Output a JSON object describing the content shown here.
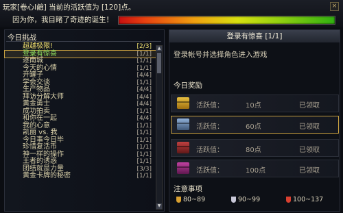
{
  "header": {
    "line1": "玩家[卷心I鹼] 当前的活跃值为 [120]点。",
    "line2": "因为你，我目睹了奇迹的诞生！",
    "close": "×"
  },
  "left": {
    "title": "今日挑战",
    "items": [
      {
        "name": "超越极限!",
        "count": "[2/3]",
        "hot": true
      },
      {
        "name": "登录有惊喜",
        "count": "[1/1]",
        "sel": true
      },
      {
        "name": "逐南城",
        "count": "[1/1]"
      },
      {
        "name": "今天的心情",
        "count": "[1/1]"
      },
      {
        "name": "开罐子",
        "count": "[4/4]"
      },
      {
        "name": "学会交谈",
        "count": "[1/1]"
      },
      {
        "name": "生产物品",
        "count": "[4/4]"
      },
      {
        "name": "拜访分解大师",
        "count": "[4/4]"
      },
      {
        "name": "黄金勇士",
        "count": "[4/4]"
      },
      {
        "name": "成功拍卖",
        "count": "[1/1]"
      },
      {
        "name": "和你在一起",
        "count": "[4/4]"
      },
      {
        "name": "我的心意",
        "count": "[1/1]"
      },
      {
        "name": "凯丽 vs. 我",
        "count": "[1/1]"
      },
      {
        "name": "今日事今日毕",
        "count": "[1/1]"
      },
      {
        "name": "珍惜复活币",
        "count": "[1/1]"
      },
      {
        "name": "神一样的操作",
        "count": "[1/1]"
      },
      {
        "name": "王者的诱惑",
        "count": "[1/1]"
      },
      {
        "name": "团结就是力量",
        "count": "[3/3]"
      },
      {
        "name": "黄金卡牌的秘密",
        "count": "[1/1]"
      }
    ],
    "scroll_up": "▲",
    "scroll_down": "▼"
  },
  "right": {
    "header": "登录有惊喜 [1/1]",
    "desc": "登录帐号并选择角色进入游戏",
    "rewards_title": "今日奖励",
    "rewards": [
      {
        "label": "活跃值：",
        "value": "10点",
        "status": "已领取"
      },
      {
        "label": "活跃值：",
        "value": "60点",
        "status": "已领取"
      },
      {
        "label": "活跃值：",
        "value": "80点",
        "status": "已领取"
      },
      {
        "label": "活跃值：",
        "value": "100点",
        "status": "已领取"
      }
    ],
    "notes_title": "注意事项",
    "medals": [
      {
        "range": "80~89",
        "color": "#d8a030"
      },
      {
        "range": "90~99",
        "color": "#c8c8d8"
      },
      {
        "range": "100~137",
        "color": "#d84030"
      }
    ]
  }
}
